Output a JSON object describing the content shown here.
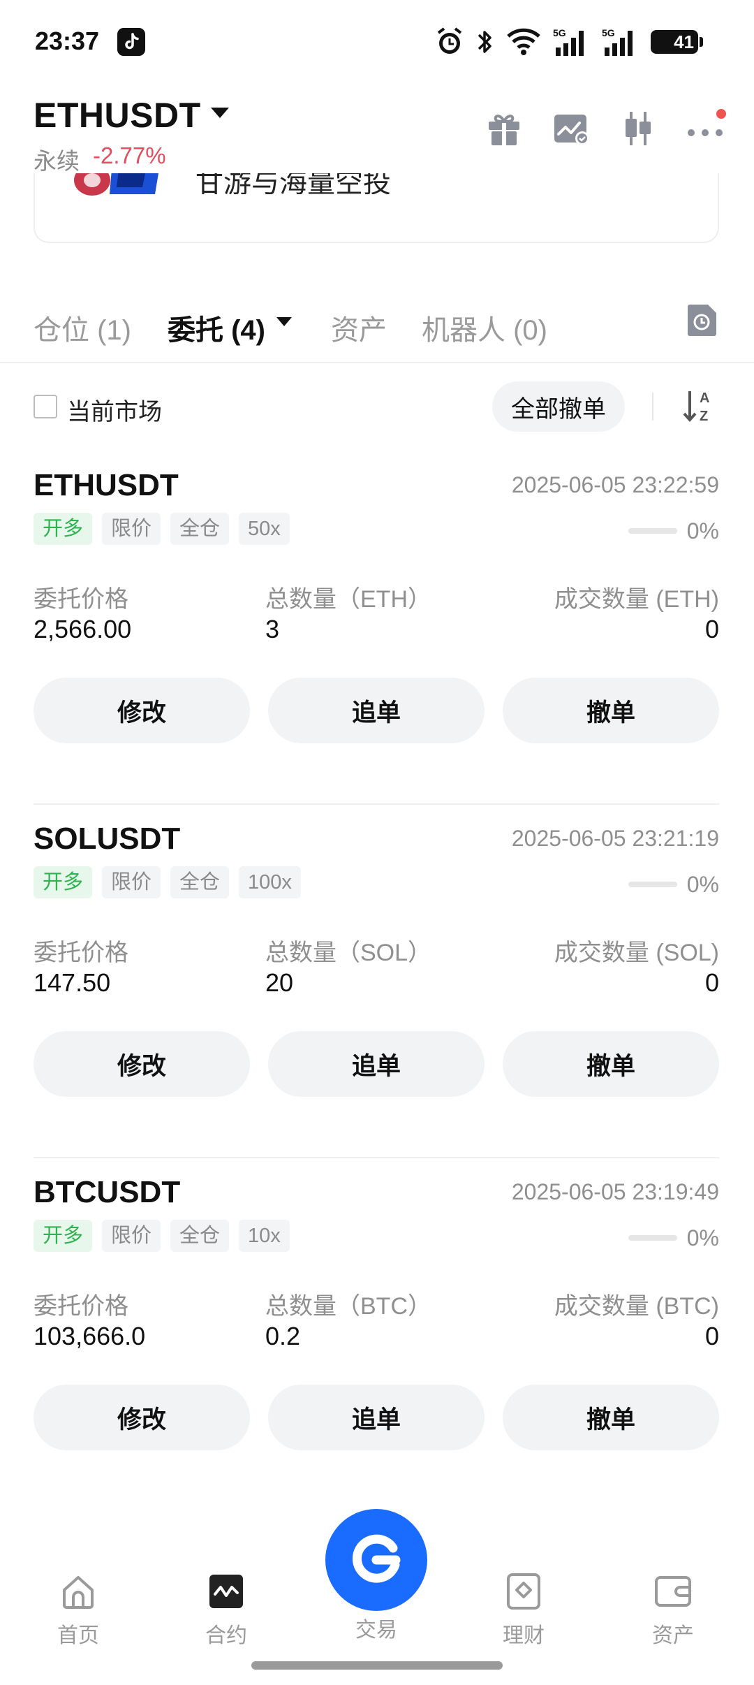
{
  "status_bar": {
    "time": "23:37",
    "battery": "41",
    "icons": [
      "tiktok-icon",
      "alarm-icon",
      "bluetooth-icon",
      "wifi-icon",
      "signal-5g-icon",
      "signal-5g-icon",
      "battery-icon"
    ]
  },
  "header": {
    "pair": "ETHUSDT",
    "contract_type": "永续",
    "change": "-2.77%",
    "icons": [
      "gift-icon",
      "chart-icon",
      "candlestick-icon",
      "more-icon"
    ]
  },
  "banner": {
    "text": "甘游与海量空投"
  },
  "tabs": [
    {
      "label": "仓位 (1)"
    },
    {
      "label": "委托 (4)"
    },
    {
      "label": "资产"
    },
    {
      "label": "机器人 (0)"
    }
  ],
  "filter": {
    "current_market_label": "当前市场",
    "cancel_all_label": "全部撤单"
  },
  "orders": [
    {
      "symbol": "ETHUSDT",
      "time": "2025-06-05 23:22:59",
      "tags": [
        "开多",
        "限价",
        "全仓",
        "50x"
      ],
      "progress": 0,
      "progress_text": "0%",
      "price_label": "委托价格",
      "price": "2,566.00",
      "qty_label": "总数量（ETH）",
      "qty": "3",
      "filled_label": "成交数量 (ETH)",
      "filled": "0",
      "buttons": [
        "修改",
        "追单",
        "撤单"
      ]
    },
    {
      "symbol": "SOLUSDT",
      "time": "2025-06-05 23:21:19",
      "tags": [
        "开多",
        "限价",
        "全仓",
        "100x"
      ],
      "progress": 0,
      "progress_text": "0%",
      "price_label": "委托价格",
      "price": "147.50",
      "qty_label": "总数量（SOL）",
      "qty": "20",
      "filled_label": "成交数量 (SOL)",
      "filled": "0",
      "buttons": [
        "修改",
        "追单",
        "撤单"
      ]
    },
    {
      "symbol": "BTCUSDT",
      "time": "2025-06-05 23:19:49",
      "tags": [
        "开多",
        "限价",
        "全仓",
        "10x"
      ],
      "progress": 0,
      "progress_text": "0%",
      "price_label": "委托价格",
      "price": "103,666.0",
      "qty_label": "总数量（BTC）",
      "qty": "0.2",
      "filled_label": "成交数量 (BTC)",
      "filled": "0",
      "buttons": [
        "修改",
        "追单",
        "撤单"
      ]
    }
  ],
  "bottom_nav": [
    {
      "label": "首页",
      "icon": "home-icon"
    },
    {
      "label": "合约",
      "icon": "futures-icon"
    },
    {
      "label": "交易",
      "icon": "trade-icon"
    },
    {
      "label": "理财",
      "icon": "earn-icon"
    },
    {
      "label": "资产",
      "icon": "wallet-icon"
    }
  ],
  "colors": {
    "accent": "#1a6bff",
    "negative": "#e24d5f",
    "long_green": "#2fb350"
  }
}
